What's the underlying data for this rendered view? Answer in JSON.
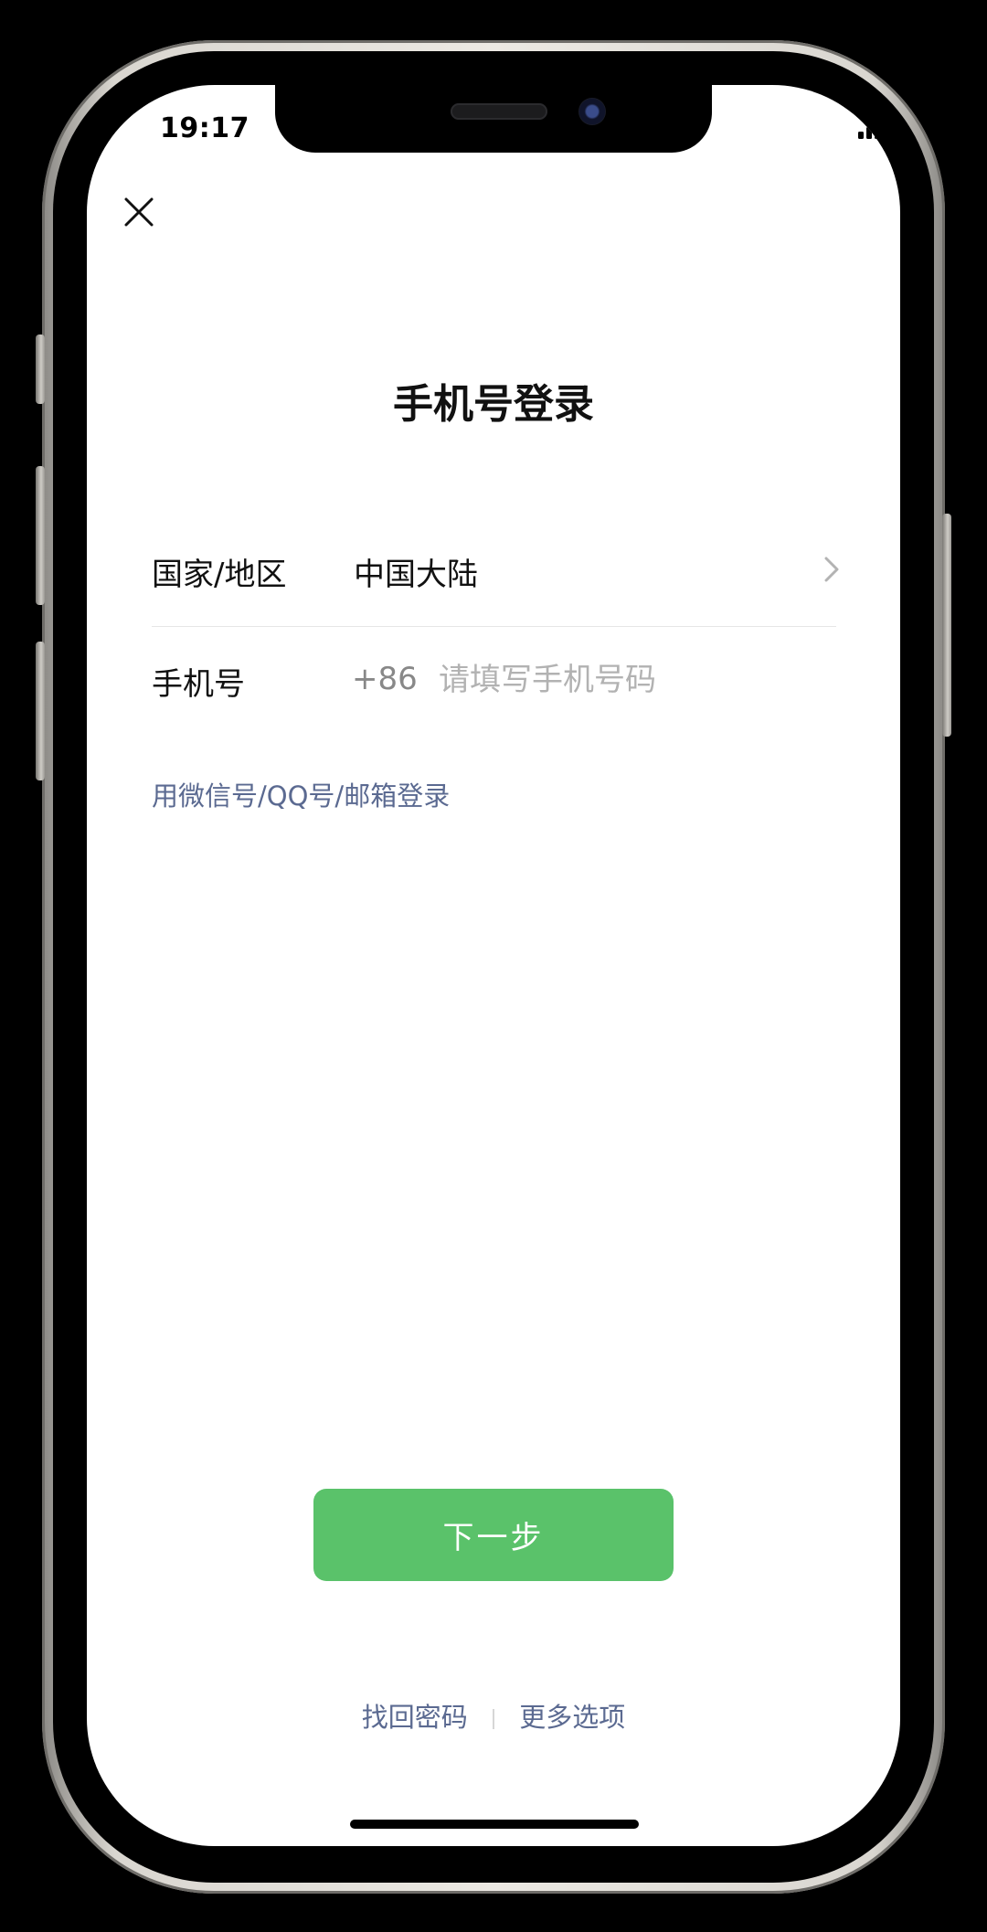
{
  "status_bar": {
    "time": "19:17",
    "battery_color": "#e0322f"
  },
  "page": {
    "title": "手机号登录"
  },
  "region_row": {
    "label": "国家/地区",
    "value": "中国大陆"
  },
  "phone_row": {
    "label": "手机号",
    "prefix": "+86",
    "placeholder": "请填写手机号码",
    "value": ""
  },
  "alt_login": {
    "label": "用微信号/QQ号/邮箱登录"
  },
  "next_button": {
    "label": "下一步",
    "color": "#5ac26a"
  },
  "footer": {
    "recover_password": "找回密码",
    "more_options": "更多选项"
  },
  "icons": {
    "close": "close-icon",
    "chevron": "chevron-right-icon",
    "signal": "cellular-signal-icon",
    "wifi": "wifi-icon",
    "battery": "battery-icon"
  }
}
